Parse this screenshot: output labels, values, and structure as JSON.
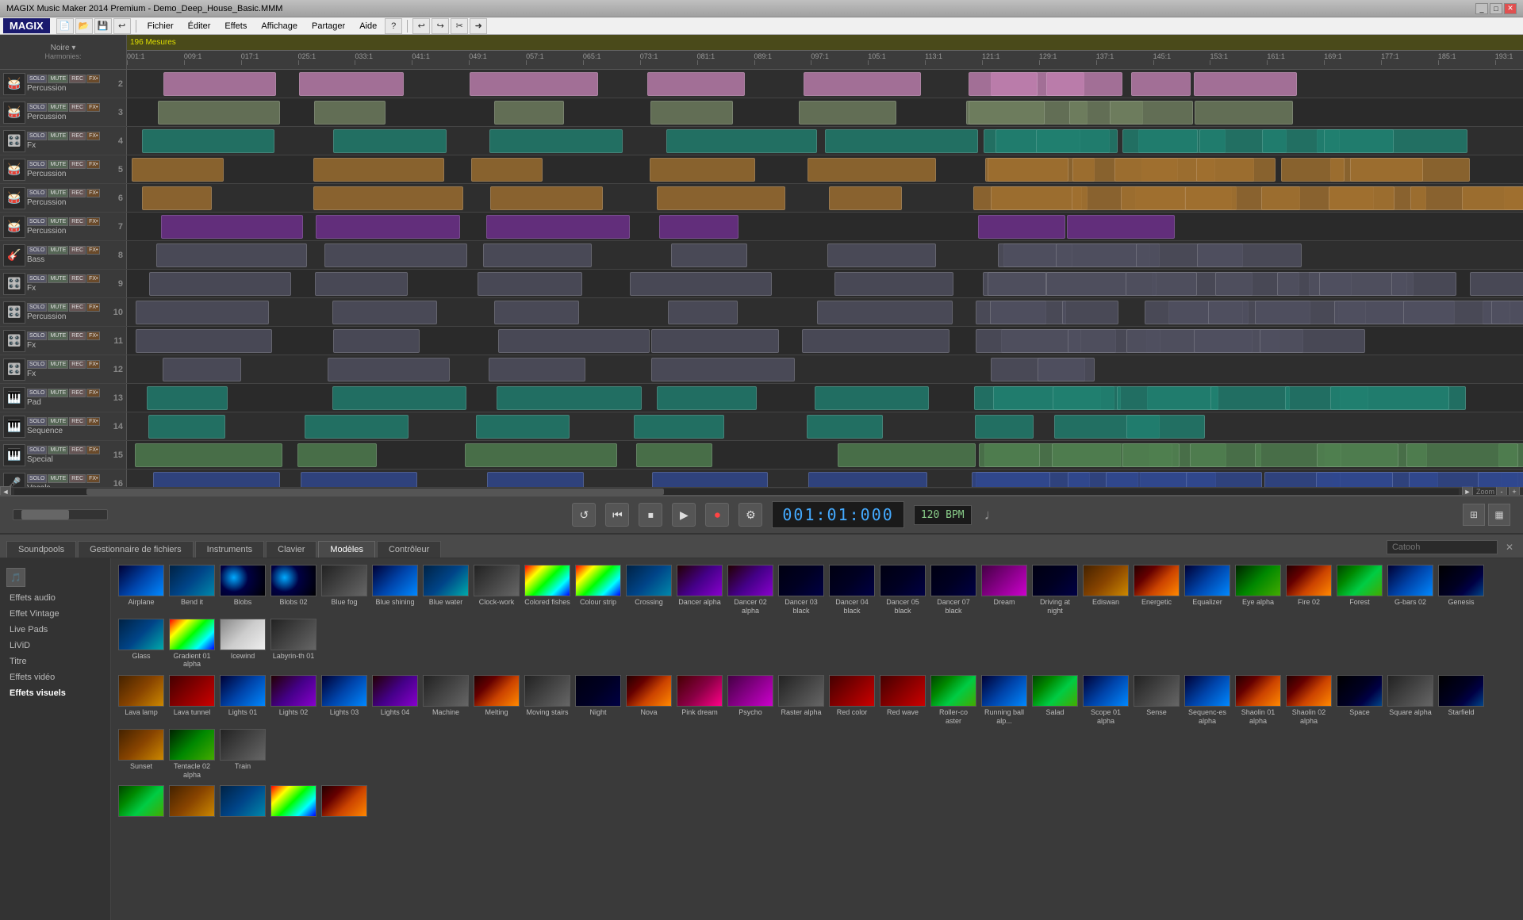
{
  "app": {
    "title": "MAGIX Music Maker 2014 Premium - Demo_Deep_House_Basic.MMM",
    "logo": "MAGIX"
  },
  "menubar": {
    "items": [
      "Fichier",
      "Éditer",
      "Effets",
      "Affichage",
      "Partager",
      "Aide"
    ]
  },
  "timeline": {
    "total_measures": "196 Mesures",
    "harmonics_label": "Harmonies:",
    "key_label": "Noire ▾",
    "marks": [
      "001:1",
      "009:1",
      "017:1",
      "025:1",
      "033:1",
      "041:1",
      "049:1",
      "057:1",
      "065:1",
      "073:1",
      "081:1",
      "089:1",
      "097:1",
      "105:1",
      "113:1",
      "121:1",
      "129:1",
      "137:1",
      "145:1",
      "153:1",
      "161:1",
      "169:1",
      "177:1",
      "185:1",
      "193:1"
    ]
  },
  "tracks": [
    {
      "id": 1,
      "instrument": "🥁",
      "name": "Percussion",
      "number": 2,
      "color": "pink",
      "type": "drums"
    },
    {
      "id": 2,
      "instrument": "🥁",
      "name": "Percussion",
      "number": 3,
      "color": "green",
      "type": "drums"
    },
    {
      "id": 3,
      "instrument": "🎛️",
      "name": "Fx",
      "number": 4,
      "color": "teal",
      "type": "fx"
    },
    {
      "id": 4,
      "instrument": "🥁",
      "name": "Percussion",
      "number": 5,
      "color": "orange",
      "type": "drums"
    },
    {
      "id": 5,
      "instrument": "🥁",
      "name": "Percussion",
      "number": 6,
      "color": "orange",
      "type": "drums"
    },
    {
      "id": 6,
      "instrument": "🥁",
      "name": "Percussion",
      "number": 7,
      "color": "purple",
      "type": "drums"
    },
    {
      "id": 7,
      "instrument": "🎸",
      "name": "Bass",
      "number": 8,
      "color": "gray",
      "type": "bass"
    },
    {
      "id": 8,
      "instrument": "🎛️",
      "name": "Fx",
      "number": 9,
      "color": "gray",
      "type": "fx"
    },
    {
      "id": 9,
      "instrument": "🎛️",
      "name": "Percussion",
      "number": 10,
      "color": "gray",
      "type": "drums"
    },
    {
      "id": 10,
      "instrument": "🎛️",
      "name": "Fx",
      "number": 11,
      "color": "gray",
      "type": "fx"
    },
    {
      "id": 11,
      "instrument": "🎛️",
      "name": "Fx",
      "number": 12,
      "color": "gray",
      "type": "fx"
    },
    {
      "id": 12,
      "instrument": "🎹",
      "name": "Pad",
      "number": 13,
      "color": "teal",
      "type": "pad"
    },
    {
      "id": 13,
      "instrument": "🎹",
      "name": "Sequence",
      "number": 14,
      "color": "teal",
      "type": "seq"
    },
    {
      "id": 14,
      "instrument": "🎹",
      "name": "Special",
      "number": 15,
      "color": "lime",
      "type": "special"
    },
    {
      "id": 15,
      "instrument": "🎤",
      "name": "Vocals",
      "number": 16,
      "color": "blue",
      "type": "vocal"
    }
  ],
  "transport": {
    "time": "001:01:000",
    "bpm": "120 BPM",
    "loop_btn": "↺",
    "rew_btn": "⏮",
    "stop_btn": "⏹",
    "play_btn": "▶",
    "rec_btn": "⏺",
    "settings_btn": "⚙"
  },
  "tabs": [
    {
      "id": "soundpools",
      "label": "Soundpools",
      "active": false
    },
    {
      "id": "file-manager",
      "label": "Gestionnaire de fichiers",
      "active": false
    },
    {
      "id": "instruments",
      "label": "Instruments",
      "active": false
    },
    {
      "id": "keyboard",
      "label": "Clavier",
      "active": false
    },
    {
      "id": "models",
      "label": "Modèles",
      "active": true
    },
    {
      "id": "controller",
      "label": "Contrôleur",
      "active": false
    }
  ],
  "search": {
    "placeholder": "Catooh",
    "value": ""
  },
  "sidebar_categories": [
    {
      "id": "audio-effects",
      "label": "Effets audio",
      "active": false
    },
    {
      "id": "vintage-effect",
      "label": "Effet Vintage",
      "active": false
    },
    {
      "id": "live-pads",
      "label": "Live Pads",
      "active": false
    },
    {
      "id": "livid",
      "label": "LiViD",
      "active": false
    },
    {
      "id": "title",
      "label": "Titre",
      "active": false
    },
    {
      "id": "video-effects",
      "label": "Effets vidéo",
      "active": false
    },
    {
      "id": "visual-effects",
      "label": "Effets visuels",
      "active": true,
      "bold": true
    }
  ],
  "media_row1": [
    {
      "id": "airplane",
      "label": "Airplane",
      "thumb_class": "thumb-blue"
    },
    {
      "id": "bend-it",
      "label": "Bend it",
      "thumb_class": "thumb-teal"
    },
    {
      "id": "blobs",
      "label": "Blobs",
      "thumb_class": "thumb-blobs"
    },
    {
      "id": "blobs-02",
      "label": "Blobs 02",
      "thumb_class": "thumb-blobs"
    },
    {
      "id": "blue-fog",
      "label": "Blue fog",
      "thumb_class": "thumb-gray"
    },
    {
      "id": "blue-shining",
      "label": "Blue shining",
      "thumb_class": "thumb-blue"
    },
    {
      "id": "blue-water",
      "label": "Blue water",
      "thumb_class": "thumb-cyan"
    },
    {
      "id": "clockwork",
      "label": "Clock-work",
      "thumb_class": "thumb-gray"
    },
    {
      "id": "colored-fishes",
      "label": "Colored fishes",
      "thumb_class": "thumb-rainbow"
    },
    {
      "id": "colour-strip",
      "label": "Colour strip",
      "thumb_class": "thumb-rainbow"
    },
    {
      "id": "crossing",
      "label": "Crossing",
      "thumb_class": "thumb-teal"
    },
    {
      "id": "dancer-alpha",
      "label": "Dancer alpha",
      "thumb_class": "thumb-purple"
    },
    {
      "id": "dancer-02-alpha",
      "label": "Dancer 02 alpha",
      "thumb_class": "thumb-purple"
    },
    {
      "id": "dancer-03-black",
      "label": "Dancer 03 black",
      "thumb_class": "thumb-darkblue"
    },
    {
      "id": "dancer-04-black",
      "label": "Dancer 04 black",
      "thumb_class": "thumb-darkblue"
    },
    {
      "id": "dancer-05-black",
      "label": "Dancer 05 black",
      "thumb_class": "thumb-darkblue"
    },
    {
      "id": "dancer-07-black",
      "label": "Dancer 07 black",
      "thumb_class": "thumb-darkblue"
    },
    {
      "id": "dream",
      "label": "Dream",
      "thumb_class": "thumb-magenta"
    },
    {
      "id": "driving-at-night",
      "label": "Driving at night",
      "thumb_class": "thumb-darkblue"
    },
    {
      "id": "ediswan",
      "label": "Ediswan",
      "thumb_class": "thumb-orange"
    },
    {
      "id": "energetic",
      "label": "Energetic",
      "thumb_class": "thumb-fire"
    },
    {
      "id": "equalizer",
      "label": "Equalizer",
      "thumb_class": "thumb-blue"
    },
    {
      "id": "eye-alpha",
      "label": "Eye alpha",
      "thumb_class": "thumb-green-waves"
    },
    {
      "id": "fire-02",
      "label": "Fire 02",
      "thumb_class": "thumb-fire"
    },
    {
      "id": "forest",
      "label": "Forest",
      "thumb_class": "thumb-nature"
    },
    {
      "id": "g-bars-02",
      "label": "G-bars 02",
      "thumb_class": "thumb-blue"
    },
    {
      "id": "genesis",
      "label": "Genesis",
      "thumb_class": "thumb-space"
    },
    {
      "id": "glass",
      "label": "Glass",
      "thumb_class": "thumb-cyan"
    },
    {
      "id": "gradient-01-alpha",
      "label": "Gradient 01 alpha",
      "thumb_class": "thumb-rainbow"
    },
    {
      "id": "icewind",
      "label": "Icewind",
      "thumb_class": "thumb-white"
    },
    {
      "id": "labyrinth-01",
      "label": "Labyrin-th 01",
      "thumb_class": "thumb-gray"
    }
  ],
  "media_row2": [
    {
      "id": "lava-lamp",
      "label": "Lava lamp",
      "thumb_class": "thumb-orange"
    },
    {
      "id": "lava-tunnel",
      "label": "Lava tunnel",
      "thumb_class": "thumb-red"
    },
    {
      "id": "lights-01",
      "label": "Lights 01",
      "thumb_class": "thumb-blue"
    },
    {
      "id": "lights-02",
      "label": "Lights 02",
      "thumb_class": "thumb-purple"
    },
    {
      "id": "lights-03",
      "label": "Lights 03",
      "thumb_class": "thumb-blue"
    },
    {
      "id": "lights-04",
      "label": "Lights 04",
      "thumb_class": "thumb-purple"
    },
    {
      "id": "machine",
      "label": "Machine",
      "thumb_class": "thumb-gray"
    },
    {
      "id": "melting",
      "label": "Melting",
      "thumb_class": "thumb-fire"
    },
    {
      "id": "moving-stairs",
      "label": "Moving stairs",
      "thumb_class": "thumb-gray"
    },
    {
      "id": "night",
      "label": "Night",
      "thumb_class": "thumb-darkblue"
    },
    {
      "id": "nova",
      "label": "Nova",
      "thumb_class": "thumb-fire"
    },
    {
      "id": "pink-dream",
      "label": "Pink dream",
      "thumb_class": "thumb-pink"
    },
    {
      "id": "psycho",
      "label": "Psycho",
      "thumb_class": "thumb-magenta"
    },
    {
      "id": "raster-alpha",
      "label": "Raster alpha",
      "thumb_class": "thumb-gray"
    },
    {
      "id": "red-color",
      "label": "Red color",
      "thumb_class": "thumb-red"
    },
    {
      "id": "red-wave",
      "label": "Red wave",
      "thumb_class": "thumb-red"
    },
    {
      "id": "rollercoaster-aster",
      "label": "Roller-co aster",
      "thumb_class": "thumb-nature"
    },
    {
      "id": "running-ball",
      "label": "Running ball alp...",
      "thumb_class": "thumb-blue"
    },
    {
      "id": "salad",
      "label": "Salad",
      "thumb_class": "thumb-nature"
    },
    {
      "id": "scope-01-alpha",
      "label": "Scope 01 alpha",
      "thumb_class": "thumb-blue"
    },
    {
      "id": "sense",
      "label": "Sense",
      "thumb_class": "thumb-gray"
    },
    {
      "id": "sequences-alpha",
      "label": "Sequenc-es alpha",
      "thumb_class": "thumb-blue"
    },
    {
      "id": "shaolin-01-alpha",
      "label": "Shaolin 01 alpha",
      "thumb_class": "thumb-fire"
    },
    {
      "id": "shaolin-02-alpha",
      "label": "Shaolin 02 alpha",
      "thumb_class": "thumb-fire"
    },
    {
      "id": "space",
      "label": "Space",
      "thumb_class": "thumb-space"
    },
    {
      "id": "square-alpha",
      "label": "Square alpha",
      "thumb_class": "thumb-gray"
    },
    {
      "id": "starfield",
      "label": "Starfield",
      "thumb_class": "thumb-space"
    },
    {
      "id": "sunset",
      "label": "Sunset",
      "thumb_class": "thumb-orange"
    },
    {
      "id": "tentacle-02-alpha",
      "label": "Tentacle 02 alpha",
      "thumb_class": "thumb-green-waves"
    },
    {
      "id": "train",
      "label": "Train",
      "thumb_class": "thumb-gray"
    }
  ],
  "media_row3": [
    {
      "id": "item-r3-1",
      "label": "",
      "thumb_class": "thumb-nature"
    },
    {
      "id": "item-r3-2",
      "label": "",
      "thumb_class": "thumb-orange"
    },
    {
      "id": "item-r3-3",
      "label": "",
      "thumb_class": "thumb-teal"
    },
    {
      "id": "item-r3-4",
      "label": "",
      "thumb_class": "thumb-rainbow"
    },
    {
      "id": "item-r3-5",
      "label": "",
      "thumb_class": "thumb-fire"
    }
  ]
}
